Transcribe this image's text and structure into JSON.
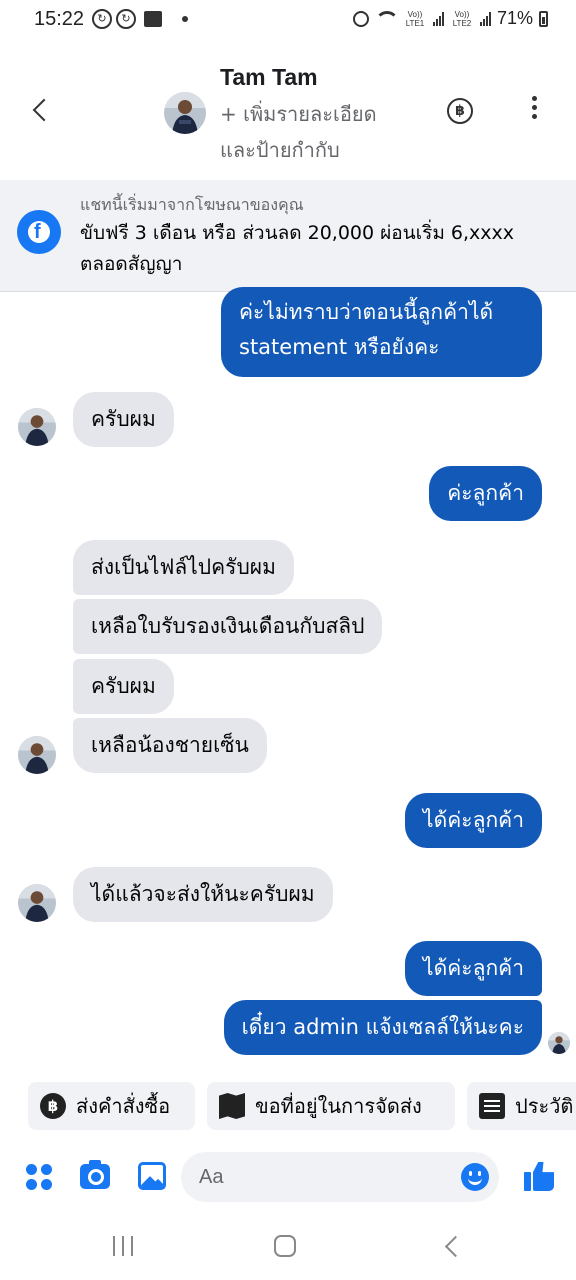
{
  "status_bar": {
    "time": "15:22",
    "battery": "71%",
    "sim1": "Vo)) LTE1",
    "sim2": "Vo)) LTE2"
  },
  "header": {
    "contact_name": "Tam Tam",
    "subtitle": "+ เพิ่มรายละเอียดและป้ายกำกับ"
  },
  "ad_banner": {
    "caption": "แชทนี้เริ่มมาจากโฆษณาของคุณ",
    "text": "ขับฟรี 3 เดือน หรือ ส่วนลด 20,000 ผ่อนเริ่ม 6,xxxx ตลอดสัญญา"
  },
  "messages": [
    {
      "side": "out",
      "text": "ค่ะไม่ทราบว่าตอนนี้ลูกค้าได้ statement หรือยังคะ"
    },
    {
      "side": "in",
      "text": "ครับผม"
    },
    {
      "side": "out",
      "text": "ค่ะลูกค้า"
    },
    {
      "side": "in",
      "text": "ส่งเป็นไฟล์ไปครับผม"
    },
    {
      "side": "in",
      "text": "เหลือใบรับรองเงินเดือนกับสลิป"
    },
    {
      "side": "in",
      "text": "ครับผม"
    },
    {
      "side": "in",
      "text": "เหลือน้องชายเซ็น"
    },
    {
      "side": "out",
      "text": "ได้ค่ะลูกค้า"
    },
    {
      "side": "in",
      "text": "ได้แล้วจะส่งให้นะครับผม"
    },
    {
      "side": "out",
      "text": "ได้ค่ะลูกค้า"
    },
    {
      "side": "out",
      "text": "เดี๋ยว admin แจ้งเซลล์ให้นะคะ"
    }
  ],
  "quick_replies": [
    {
      "label": "ส่งคำสั่งซื้อ",
      "icon": "baht-icon"
    },
    {
      "label": "ขอที่อยู่ในการจัดส่ง",
      "icon": "map-icon"
    },
    {
      "label": "ประวัติ",
      "icon": "document-icon"
    }
  ],
  "composer": {
    "placeholder": "Aa"
  },
  "colors": {
    "outgoing_bubble": "#1259b8",
    "incoming_bubble": "#e4e6eb",
    "accent": "#1877f2"
  }
}
